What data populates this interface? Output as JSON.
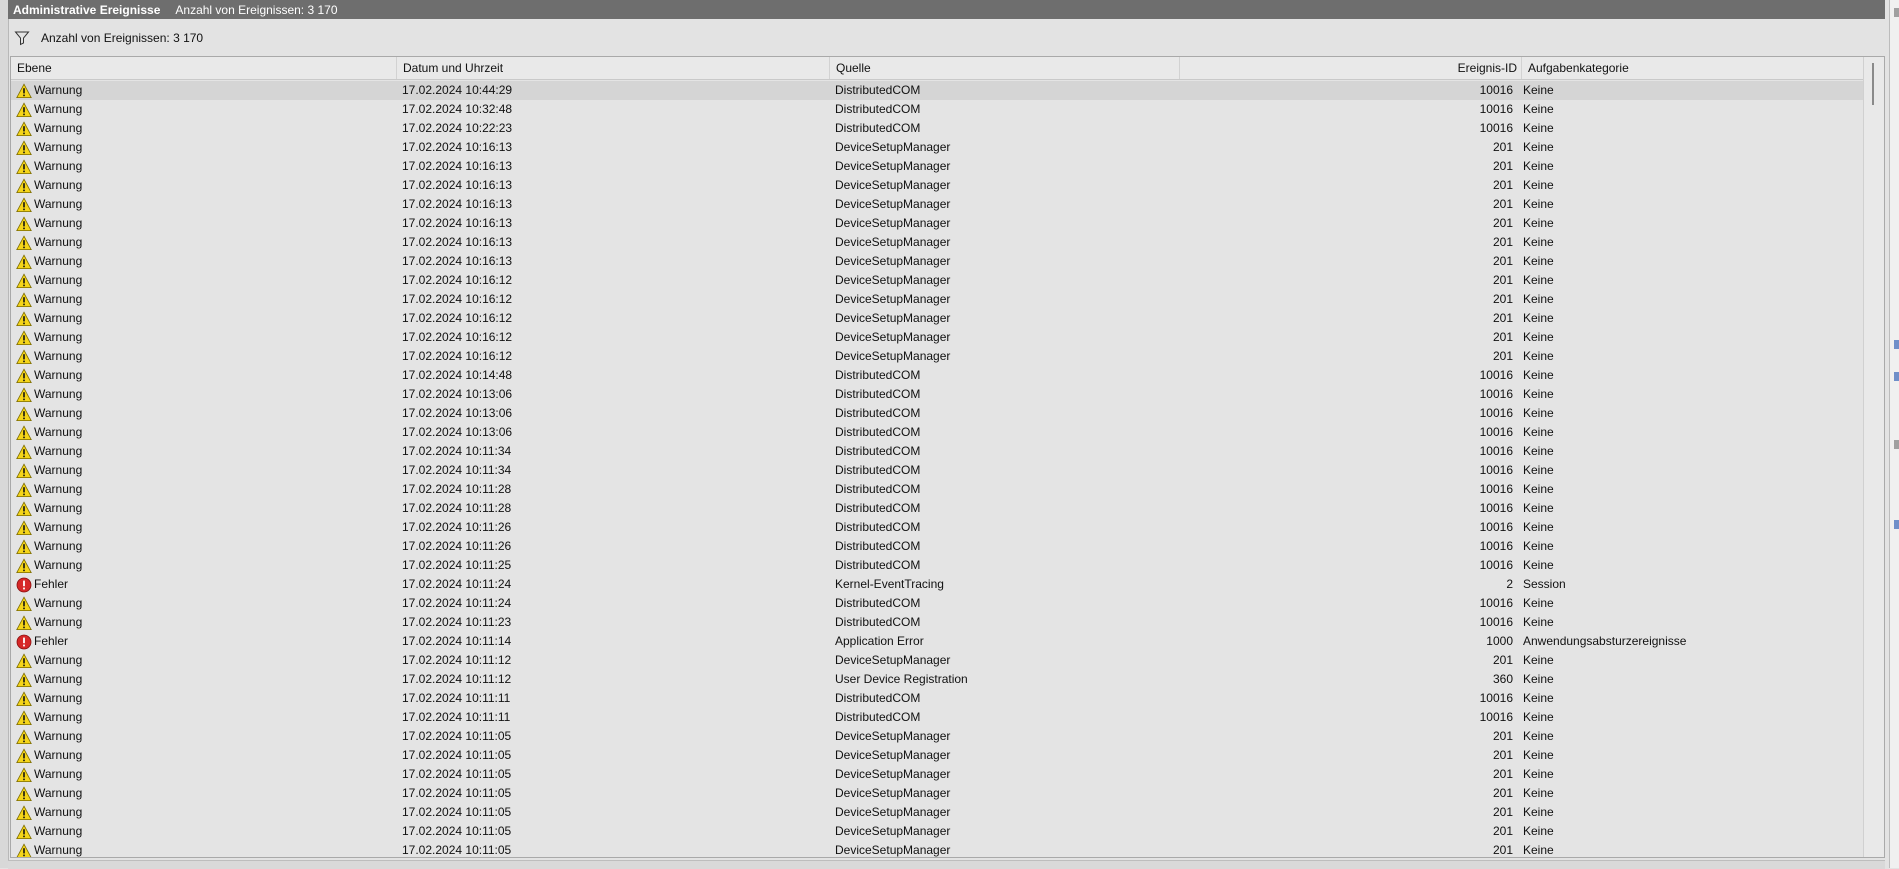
{
  "titlebar": {
    "title": "Administrative Ereignisse",
    "count": "Anzahl von Ereignissen: 3 170"
  },
  "filter": {
    "label": "Anzahl von Ereignissen: 3 170"
  },
  "columns": {
    "level": "Ebene",
    "date": "Datum und Uhrzeit",
    "source": "Quelle",
    "id": "Ereignis-ID",
    "category": "Aufgabenkategorie"
  },
  "rows": [
    {
      "level": "Warnung",
      "type": "warning",
      "date": "17.02.2024 10:44:29",
      "source": "DistributedCOM",
      "id": "10016",
      "category": "Keine"
    },
    {
      "level": "Warnung",
      "type": "warning",
      "date": "17.02.2024 10:32:48",
      "source": "DistributedCOM",
      "id": "10016",
      "category": "Keine"
    },
    {
      "level": "Warnung",
      "type": "warning",
      "date": "17.02.2024 10:22:23",
      "source": "DistributedCOM",
      "id": "10016",
      "category": "Keine"
    },
    {
      "level": "Warnung",
      "type": "warning",
      "date": "17.02.2024 10:16:13",
      "source": "DeviceSetupManager",
      "id": "201",
      "category": "Keine"
    },
    {
      "level": "Warnung",
      "type": "warning",
      "date": "17.02.2024 10:16:13",
      "source": "DeviceSetupManager",
      "id": "201",
      "category": "Keine"
    },
    {
      "level": "Warnung",
      "type": "warning",
      "date": "17.02.2024 10:16:13",
      "source": "DeviceSetupManager",
      "id": "201",
      "category": "Keine"
    },
    {
      "level": "Warnung",
      "type": "warning",
      "date": "17.02.2024 10:16:13",
      "source": "DeviceSetupManager",
      "id": "201",
      "category": "Keine"
    },
    {
      "level": "Warnung",
      "type": "warning",
      "date": "17.02.2024 10:16:13",
      "source": "DeviceSetupManager",
      "id": "201",
      "category": "Keine"
    },
    {
      "level": "Warnung",
      "type": "warning",
      "date": "17.02.2024 10:16:13",
      "source": "DeviceSetupManager",
      "id": "201",
      "category": "Keine"
    },
    {
      "level": "Warnung",
      "type": "warning",
      "date": "17.02.2024 10:16:13",
      "source": "DeviceSetupManager",
      "id": "201",
      "category": "Keine"
    },
    {
      "level": "Warnung",
      "type": "warning",
      "date": "17.02.2024 10:16:12",
      "source": "DeviceSetupManager",
      "id": "201",
      "category": "Keine"
    },
    {
      "level": "Warnung",
      "type": "warning",
      "date": "17.02.2024 10:16:12",
      "source": "DeviceSetupManager",
      "id": "201",
      "category": "Keine"
    },
    {
      "level": "Warnung",
      "type": "warning",
      "date": "17.02.2024 10:16:12",
      "source": "DeviceSetupManager",
      "id": "201",
      "category": "Keine"
    },
    {
      "level": "Warnung",
      "type": "warning",
      "date": "17.02.2024 10:16:12",
      "source": "DeviceSetupManager",
      "id": "201",
      "category": "Keine"
    },
    {
      "level": "Warnung",
      "type": "warning",
      "date": "17.02.2024 10:16:12",
      "source": "DeviceSetupManager",
      "id": "201",
      "category": "Keine"
    },
    {
      "level": "Warnung",
      "type": "warning",
      "date": "17.02.2024 10:14:48",
      "source": "DistributedCOM",
      "id": "10016",
      "category": "Keine"
    },
    {
      "level": "Warnung",
      "type": "warning",
      "date": "17.02.2024 10:13:06",
      "source": "DistributedCOM",
      "id": "10016",
      "category": "Keine"
    },
    {
      "level": "Warnung",
      "type": "warning",
      "date": "17.02.2024 10:13:06",
      "source": "DistributedCOM",
      "id": "10016",
      "category": "Keine"
    },
    {
      "level": "Warnung",
      "type": "warning",
      "date": "17.02.2024 10:13:06",
      "source": "DistributedCOM",
      "id": "10016",
      "category": "Keine"
    },
    {
      "level": "Warnung",
      "type": "warning",
      "date": "17.02.2024 10:11:34",
      "source": "DistributedCOM",
      "id": "10016",
      "category": "Keine"
    },
    {
      "level": "Warnung",
      "type": "warning",
      "date": "17.02.2024 10:11:34",
      "source": "DistributedCOM",
      "id": "10016",
      "category": "Keine"
    },
    {
      "level": "Warnung",
      "type": "warning",
      "date": "17.02.2024 10:11:28",
      "source": "DistributedCOM",
      "id": "10016",
      "category": "Keine"
    },
    {
      "level": "Warnung",
      "type": "warning",
      "date": "17.02.2024 10:11:28",
      "source": "DistributedCOM",
      "id": "10016",
      "category": "Keine"
    },
    {
      "level": "Warnung",
      "type": "warning",
      "date": "17.02.2024 10:11:26",
      "source": "DistributedCOM",
      "id": "10016",
      "category": "Keine"
    },
    {
      "level": "Warnung",
      "type": "warning",
      "date": "17.02.2024 10:11:26",
      "source": "DistributedCOM",
      "id": "10016",
      "category": "Keine"
    },
    {
      "level": "Warnung",
      "type": "warning",
      "date": "17.02.2024 10:11:25",
      "source": "DistributedCOM",
      "id": "10016",
      "category": "Keine"
    },
    {
      "level": "Fehler",
      "type": "error",
      "date": "17.02.2024 10:11:24",
      "source": "Kernel-EventTracing",
      "id": "2",
      "category": "Session"
    },
    {
      "level": "Warnung",
      "type": "warning",
      "date": "17.02.2024 10:11:24",
      "source": "DistributedCOM",
      "id": "10016",
      "category": "Keine"
    },
    {
      "level": "Warnung",
      "type": "warning",
      "date": "17.02.2024 10:11:23",
      "source": "DistributedCOM",
      "id": "10016",
      "category": "Keine"
    },
    {
      "level": "Fehler",
      "type": "error",
      "date": "17.02.2024 10:11:14",
      "source": "Application Error",
      "id": "1000",
      "category": "Anwendungsabsturzereignisse"
    },
    {
      "level": "Warnung",
      "type": "warning",
      "date": "17.02.2024 10:11:12",
      "source": "DeviceSetupManager",
      "id": "201",
      "category": "Keine"
    },
    {
      "level": "Warnung",
      "type": "warning",
      "date": "17.02.2024 10:11:12",
      "source": "User Device Registration",
      "id": "360",
      "category": "Keine"
    },
    {
      "level": "Warnung",
      "type": "warning",
      "date": "17.02.2024 10:11:11",
      "source": "DistributedCOM",
      "id": "10016",
      "category": "Keine"
    },
    {
      "level": "Warnung",
      "type": "warning",
      "date": "17.02.2024 10:11:11",
      "source": "DistributedCOM",
      "id": "10016",
      "category": "Keine"
    },
    {
      "level": "Warnung",
      "type": "warning",
      "date": "17.02.2024 10:11:05",
      "source": "DeviceSetupManager",
      "id": "201",
      "category": "Keine"
    },
    {
      "level": "Warnung",
      "type": "warning",
      "date": "17.02.2024 10:11:05",
      "source": "DeviceSetupManager",
      "id": "201",
      "category": "Keine"
    },
    {
      "level": "Warnung",
      "type": "warning",
      "date": "17.02.2024 10:11:05",
      "source": "DeviceSetupManager",
      "id": "201",
      "category": "Keine"
    },
    {
      "level": "Warnung",
      "type": "warning",
      "date": "17.02.2024 10:11:05",
      "source": "DeviceSetupManager",
      "id": "201",
      "category": "Keine"
    },
    {
      "level": "Warnung",
      "type": "warning",
      "date": "17.02.2024 10:11:05",
      "source": "DeviceSetupManager",
      "id": "201",
      "category": "Keine"
    },
    {
      "level": "Warnung",
      "type": "warning",
      "date": "17.02.2024 10:11:05",
      "source": "DeviceSetupManager",
      "id": "201",
      "category": "Keine"
    },
    {
      "level": "Warnung",
      "type": "warning",
      "date": "17.02.2024 10:11:05",
      "source": "DeviceSetupManager",
      "id": "201",
      "category": "Keine"
    }
  ],
  "colors": {
    "titlebar": "#6e6e6e",
    "warning": "#f5d51a",
    "error": "#d62828",
    "selected_row": "#d5d5d5"
  },
  "icons": {
    "warning": "warning-icon",
    "error": "error-icon",
    "filter": "filter-icon"
  }
}
